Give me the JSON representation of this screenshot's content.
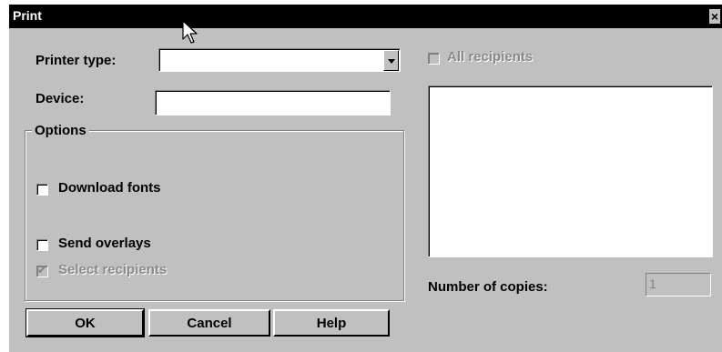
{
  "window": {
    "title": "Print",
    "close_glyph": "×"
  },
  "printer_type": {
    "label": "Printer type:",
    "value": ""
  },
  "device": {
    "label": "Device:",
    "value": ""
  },
  "options": {
    "legend": "Options",
    "download_fonts": {
      "label": "Download fonts",
      "checked": false
    },
    "send_overlays": {
      "label": "Send overlays",
      "checked": false
    },
    "select_recipients": {
      "label": "Select recipients",
      "checked": true,
      "disabled": true,
      "check_glyph": "✔"
    }
  },
  "recipients": {
    "all_label": "All recipients",
    "all_checked": false,
    "all_disabled": true,
    "items": []
  },
  "copies": {
    "label": "Number of copies:",
    "value": "1"
  },
  "buttons": {
    "ok": "OK",
    "cancel": "Cancel",
    "help": "Help"
  },
  "icons": {
    "cursor": "arrow-cursor-icon",
    "dropdown": "chevron-down-icon",
    "close": "close-icon"
  },
  "colors": {
    "face": "#c0c0c0",
    "titlebar": "#000000",
    "disabled_text": "#8a8a8a"
  }
}
